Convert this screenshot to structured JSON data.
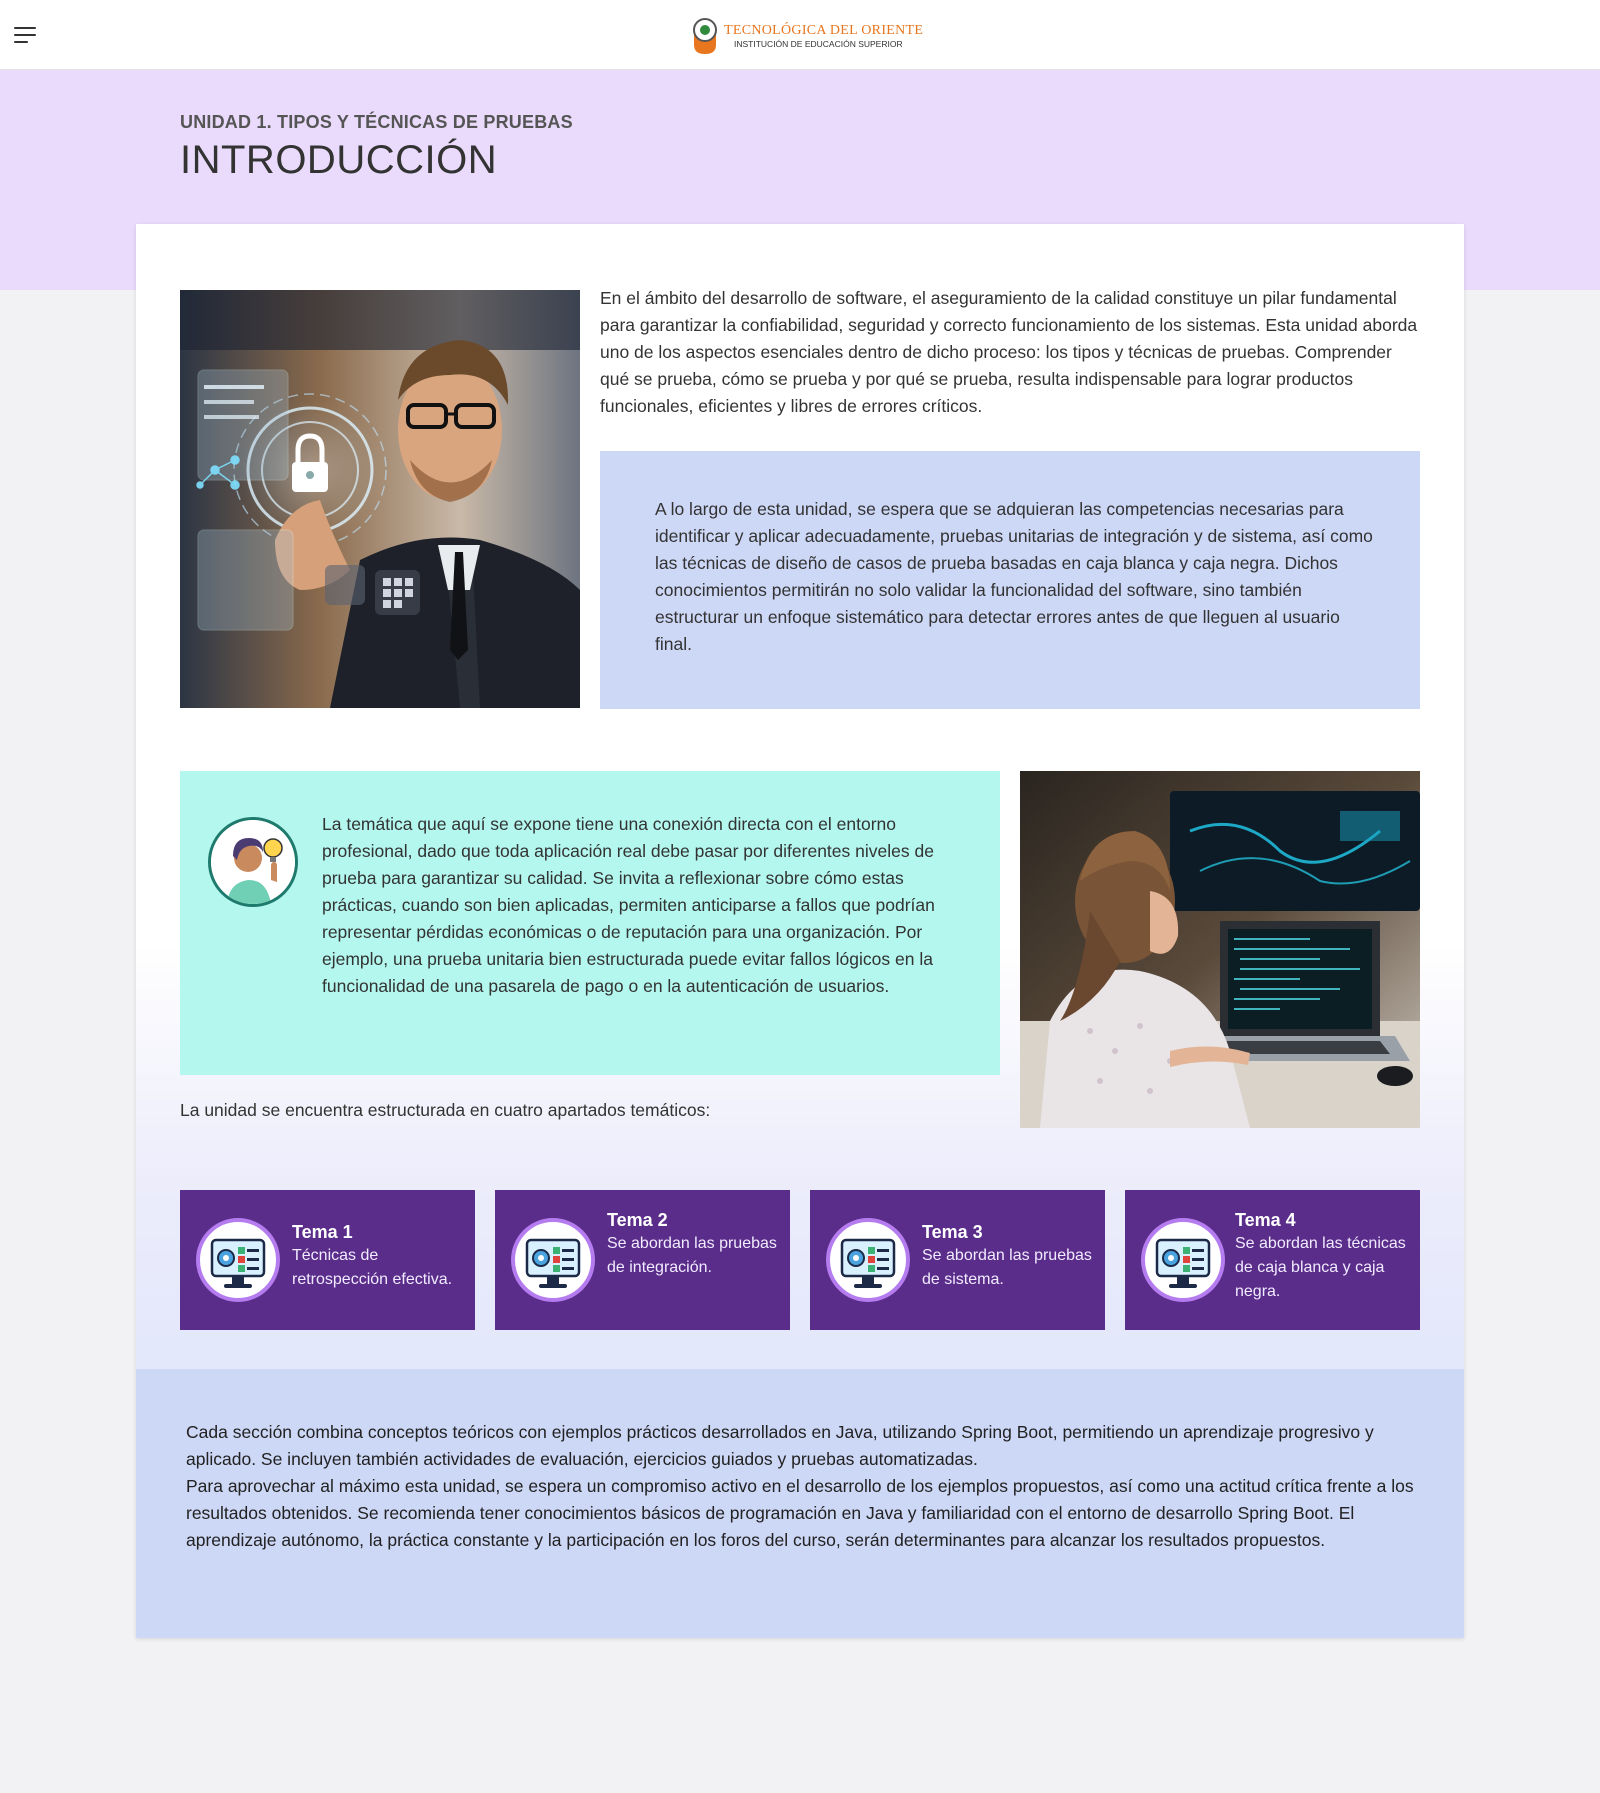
{
  "header": {
    "menu_icon": "hamburger-menu-icon",
    "logo_name": "TECNOLÓGICA DEL ORIENTE",
    "logo_sub": "INSTITUCIÓN DE EDUCACIÓN SUPERIOR",
    "logo_colors": {
      "orange": "#e8761f",
      "green": "#2f8a3c"
    }
  },
  "hero": {
    "unit_label": "UNIDAD 1. TIPOS Y TÉCNICAS DE PRUEBAS",
    "title": "INTRODUCCIÓN"
  },
  "intro": {
    "paragraph": " En el ámbito del desarrollo de software, el aseguramiento de la calidad constituye un pilar fundamental para garantizar la confiabilidad, seguridad y correcto funcionamiento de los sistemas. Esta unidad aborda uno de los aspectos esenciales dentro de dicho proceso: los tipos y técnicas de pruebas. Comprender qué se prueba, cómo se prueba y por qué se prueba, resulta indispensable para lograr productos funcionales, eficientes y libres de errores críticos.",
    "highlight": "A lo largo de esta unidad, se espera que se adquieran las competencias necesarias para identificar y aplicar adecuadamente, pruebas unitarias de integración y de sistema, así como las técnicas de diseño de casos de prueba basadas en caja blanca y caja negra. Dichos conocimientos permitirán no solo validar la funcionalidad del software, sino también estructurar un enfoque sistemático para detectar errores antes de que lleguen al usuario final."
  },
  "reflection": {
    "icon": "idea-person-icon",
    "text": "La temática que aquí se expone tiene una conexión directa con el entorno profesional, dado que toda aplicación real debe pasar por diferentes niveles de prueba para garantizar su calidad. Se invita a reflexionar sobre cómo estas prácticas, cuando son bien aplicadas, permiten anticiparse a fallos que podrían representar pérdidas económicas o de reputación para una organización. Por ejemplo, una prueba unitaria bien estructurada puede evitar fallos lógicos en la funcionalidad de una pasarela de pago o en la autenticación de usuarios."
  },
  "structure_text": "La unidad se encuentra estructurada en cuatro apartados temáticos:",
  "temas": [
    {
      "title": "Tema 1",
      "desc": "Técnicas de retrospección efectiva.",
      "icon": "software-testing-monitor-icon"
    },
    {
      "title": "Tema 2",
      "desc": "Se abordan  las pruebas de integración.",
      "icon": "software-testing-monitor-icon"
    },
    {
      "title": "Tema 3",
      "desc": "Se abordan las pruebas de sistema.",
      "icon": "software-testing-monitor-icon"
    },
    {
      "title": "Tema 4",
      "desc": "Se abordan las técnicas de caja blanca y caja negra.",
      "icon": "software-testing-monitor-icon"
    }
  ],
  "closing": {
    "p1": "Cada sección combina conceptos teóricos con ejemplos prácticos desarrollados en Java, utilizando Spring Boot, permitiendo un aprendizaje progresivo y aplicado. Se incluyen también actividades de evaluación, ejercicios guiados y pruebas automatizadas.",
    "p2": "Para aprovechar al máximo esta unidad, se espera un compromiso activo en el desarrollo de los ejemplos propuestos, así como una actitud crítica frente a los resultados obtenidos. Se recomienda tener conocimientos básicos de programación en Java y familiaridad con el entorno de desarrollo Spring Boot. El aprendizaje autónomo, la práctica constante y la participación en los foros del curso, serán determinantes para alcanzar los resultados propuestos."
  },
  "colors": {
    "hero_band": "#eadbfc",
    "blue_box": "#cdd7f6",
    "teal_box": "#b3f7ee",
    "tema_card": "#5b2d8a"
  }
}
